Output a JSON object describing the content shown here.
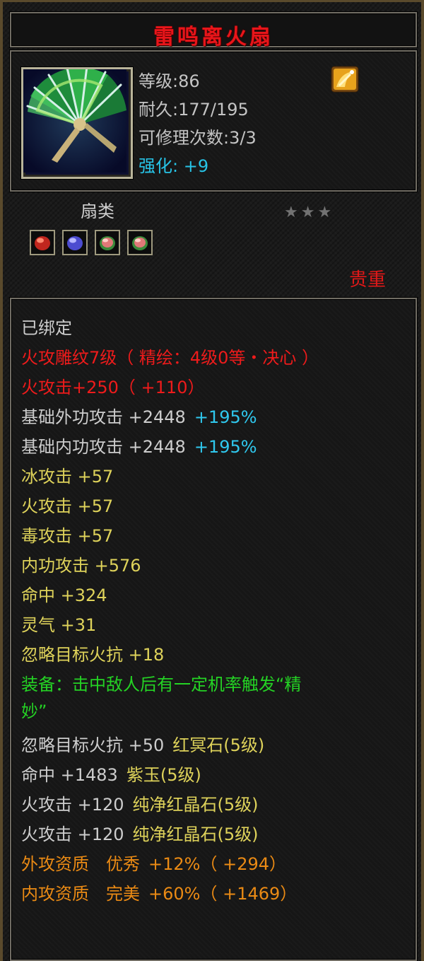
{
  "item": {
    "name": "雷鸣离火扇",
    "level": "等级:86",
    "durability": "耐久:177/195",
    "repair": "可修理次数:3/3",
    "strength_label": "强化:",
    "strength_value": "+9",
    "category": "扇类",
    "stars": "★★★",
    "rarity": "贵重"
  },
  "gems": [
    {
      "icon": "red-gem-icon",
      "color": "#c0261e"
    },
    {
      "icon": "purple-gem-icon",
      "color": "#5a5ad8"
    },
    {
      "icon": "pink-gem-icon",
      "color": "#d86a6a"
    },
    {
      "icon": "pink-gem-icon",
      "color": "#d86a6a"
    }
  ],
  "attributes": {
    "bound": "已绑定",
    "engrave": "火攻雕纹7级（ 精绘：4级0等・决心 ）",
    "fire_attack": "火攻击+250（ +110）",
    "base_ext_label": "基础外功攻击 +2448",
    "base_ext_pct": "+195%",
    "base_int_label": "基础内功攻击 +2448",
    "base_int_pct": "+195%",
    "ice": "冰攻击 +57",
    "fire": "火攻击 +57",
    "poison": "毒攻击 +57",
    "internal": "内功攻击 +576",
    "hit": "命中 +324",
    "spirit": "灵气 +31",
    "ignore_fire": "忽略目标火抗 +18",
    "equip_line1": "装备：击中敌人后有一定机率触发“精",
    "equip_line2": "妙”",
    "gem1_base": "忽略目标火抗 +50",
    "gem1_name": "红冥石(5级)",
    "gem2_base": "命中 +1483",
    "gem2_name": "紫玉(5级)",
    "gem3_base": "火攻击 +120",
    "gem3_name": "纯净红晶石(5级)",
    "gem4_base": "火攻击 +120",
    "gem4_name": "纯净红晶石(5级)",
    "ext_quality_label": "外攻资质",
    "ext_quality_grade": "优秀",
    "ext_quality_value": "+12%（ +294）",
    "int_quality_label": "内攻资质",
    "int_quality_grade": "完美",
    "int_quality_value": "+60%（ +1469）"
  }
}
